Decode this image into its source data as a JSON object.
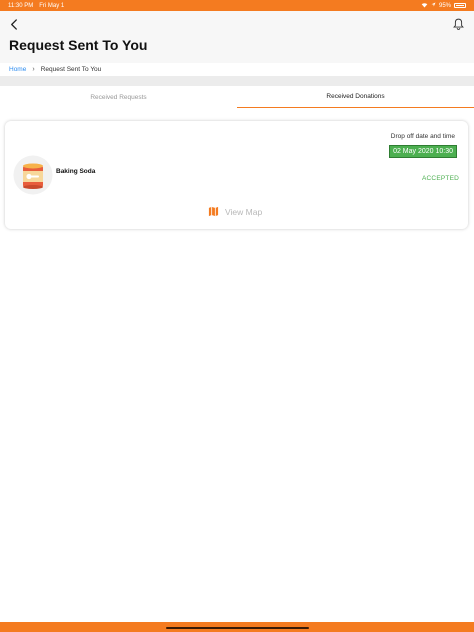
{
  "status_bar": {
    "time": "11:30 PM",
    "date": "Fri May 1",
    "battery": "95%"
  },
  "header": {
    "title": "Request Sent To You"
  },
  "breadcrumb": {
    "home": "Home",
    "separator": "›",
    "current": "Request Sent To You"
  },
  "tabs": [
    {
      "label": "Received Requests",
      "active": false
    },
    {
      "label": "Received Donations",
      "active": true
    }
  ],
  "donation": {
    "product_name": "Baking Soda",
    "dropoff_label": "Drop off date and time",
    "dropoff_datetime": "02 May 2020 10:30",
    "status": "ACCEPTED",
    "view_map_label": "View Map"
  },
  "colors": {
    "accent": "#f47b20",
    "success": "#4caf50",
    "link": "#2d8cf0"
  },
  "icons": [
    "back-chevron-icon",
    "bell-icon",
    "map-icon",
    "wifi-icon",
    "location-arrow-icon",
    "battery-icon"
  ]
}
